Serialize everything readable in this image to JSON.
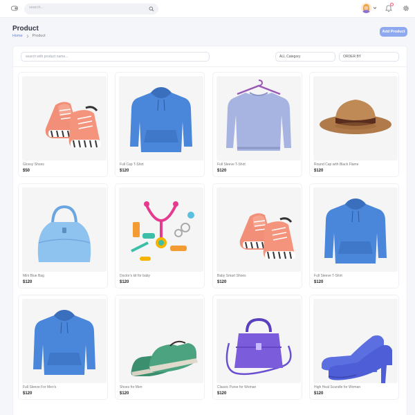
{
  "topbar": {
    "search_placeholder": "search...",
    "icons": {
      "toggle": "sidebar-toggle-icon",
      "search": "search-icon",
      "notification": "bell-icon",
      "settings": "gear-icon",
      "dropdown": "chevron-down-icon"
    }
  },
  "header": {
    "title": "Product",
    "breadcrumb": [
      "Home",
      "Product"
    ],
    "add_button": "Add Product"
  },
  "filters": {
    "search_placeholder": "search with product name...",
    "category": "ALL Category",
    "order": "ORDER BY"
  },
  "colors": {
    "accent": "#8fa9f0",
    "link": "#5b7fdb",
    "notification": "#ee5a6f"
  },
  "products": [
    {
      "name": "Glossy Shoes",
      "price": "$50",
      "image": "baby-shoes"
    },
    {
      "name": "Full Cap T-Shirt",
      "price": "$120",
      "image": "blue-hoodie"
    },
    {
      "name": "Full Sleeve T-Shirt",
      "price": "$120",
      "image": "sweater-on-hanger"
    },
    {
      "name": "Round Cap with Black Flame",
      "price": "$120",
      "image": "brown-hat"
    },
    {
      "name": "Mini Blue Bag",
      "price": "$120",
      "image": "blue-handbag"
    },
    {
      "name": "Doctor's kit for baby",
      "price": "$120",
      "image": "toy-doctor-kit"
    },
    {
      "name": "Baby Smart Shoes",
      "price": "$120",
      "image": "baby-shoes"
    },
    {
      "name": "Full Sleeve T-Shirt",
      "price": "$120",
      "image": "blue-hoodie"
    },
    {
      "name": "Full Sleeve For Men's",
      "price": "$120",
      "image": "blue-hoodie"
    },
    {
      "name": "Shoes for Men",
      "price": "$120",
      "image": "green-shoes"
    },
    {
      "name": "Classic Purse for Woman",
      "price": "$120",
      "image": "purple-purse"
    },
    {
      "name": "High Heal Scandle for Woman",
      "price": "$120",
      "image": "blue-heels"
    }
  ]
}
